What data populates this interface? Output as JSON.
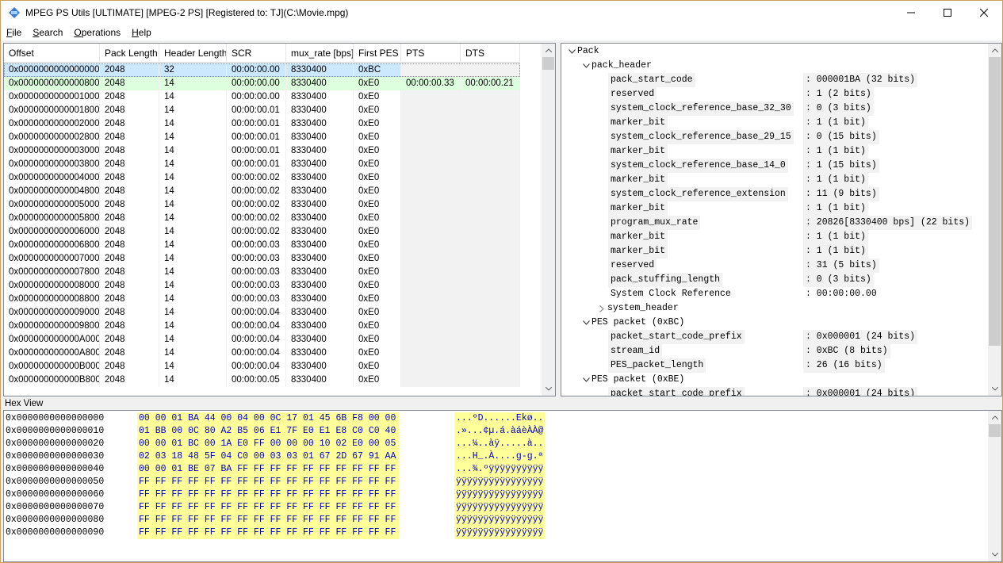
{
  "window": {
    "title": "MPEG PS Utils  [ULTIMATE] [MPEG-2 PS] [Registered to: TJ](C:\\Movie.mpg)"
  },
  "menu": [
    {
      "u": "F",
      "rest": "ile"
    },
    {
      "u": "S",
      "rest": "earch"
    },
    {
      "u": "O",
      "rest": "perations"
    },
    {
      "u": "H",
      "rest": "elp"
    }
  ],
  "grid": {
    "columns": [
      "Offset",
      "Pack Length",
      "Header Length",
      "SCR",
      "mux_rate [bps]",
      "First PES",
      "PTS",
      "DTS"
    ],
    "rows": [
      [
        "0x0000000000000000",
        "2048",
        "32",
        "00:00:00.00",
        "8330400",
        "0xBC",
        "",
        ""
      ],
      [
        "0x0000000000000800",
        "2048",
        "14",
        "00:00:00.00",
        "8330400",
        "0xE0",
        "00:00:00.33",
        "00:00:00.21"
      ],
      [
        "0x0000000000001000",
        "2048",
        "14",
        "00:00:00.00",
        "8330400",
        "0xE0",
        "",
        ""
      ],
      [
        "0x0000000000001800",
        "2048",
        "14",
        "00:00:00.01",
        "8330400",
        "0xE0",
        "",
        ""
      ],
      [
        "0x0000000000002000",
        "2048",
        "14",
        "00:00:00.01",
        "8330400",
        "0xE0",
        "",
        ""
      ],
      [
        "0x0000000000002800",
        "2048",
        "14",
        "00:00:00.01",
        "8330400",
        "0xE0",
        "",
        ""
      ],
      [
        "0x0000000000003000",
        "2048",
        "14",
        "00:00:00.01",
        "8330400",
        "0xE0",
        "",
        ""
      ],
      [
        "0x0000000000003800",
        "2048",
        "14",
        "00:00:00.01",
        "8330400",
        "0xE0",
        "",
        ""
      ],
      [
        "0x0000000000004000",
        "2048",
        "14",
        "00:00:00.02",
        "8330400",
        "0xE0",
        "",
        ""
      ],
      [
        "0x0000000000004800",
        "2048",
        "14",
        "00:00:00.02",
        "8330400",
        "0xE0",
        "",
        ""
      ],
      [
        "0x0000000000005000",
        "2048",
        "14",
        "00:00:00.02",
        "8330400",
        "0xE0",
        "",
        ""
      ],
      [
        "0x0000000000005800",
        "2048",
        "14",
        "00:00:00.02",
        "8330400",
        "0xE0",
        "",
        ""
      ],
      [
        "0x0000000000006000",
        "2048",
        "14",
        "00:00:00.02",
        "8330400",
        "0xE0",
        "",
        ""
      ],
      [
        "0x0000000000006800",
        "2048",
        "14",
        "00:00:00.03",
        "8330400",
        "0xE0",
        "",
        ""
      ],
      [
        "0x0000000000007000",
        "2048",
        "14",
        "00:00:00.03",
        "8330400",
        "0xE0",
        "",
        ""
      ],
      [
        "0x0000000000007800",
        "2048",
        "14",
        "00:00:00.03",
        "8330400",
        "0xE0",
        "",
        ""
      ],
      [
        "0x0000000000008000",
        "2048",
        "14",
        "00:00:00.03",
        "8330400",
        "0xE0",
        "",
        ""
      ],
      [
        "0x0000000000008800",
        "2048",
        "14",
        "00:00:00.03",
        "8330400",
        "0xE0",
        "",
        ""
      ],
      [
        "0x0000000000009000",
        "2048",
        "14",
        "00:00:00.04",
        "8330400",
        "0xE0",
        "",
        ""
      ],
      [
        "0x0000000000009800",
        "2048",
        "14",
        "00:00:00.04",
        "8330400",
        "0xE0",
        "",
        ""
      ],
      [
        "0x000000000000A000",
        "2048",
        "14",
        "00:00:00.04",
        "8330400",
        "0xE0",
        "",
        ""
      ],
      [
        "0x000000000000A800",
        "2048",
        "14",
        "00:00:00.04",
        "8330400",
        "0xE0",
        "",
        ""
      ],
      [
        "0x000000000000B000",
        "2048",
        "14",
        "00:00:00.04",
        "8330400",
        "0xE0",
        "",
        ""
      ],
      [
        "0x000000000000B800",
        "2048",
        "14",
        "00:00:00.05",
        "8330400",
        "0xE0",
        "",
        ""
      ]
    ],
    "selected_row": 0,
    "highlight_row": 1
  },
  "tree": [
    {
      "level": 0,
      "expander": "open",
      "label": "Pack"
    },
    {
      "level": 1,
      "expander": "open",
      "label": "pack_header"
    },
    {
      "level": 2,
      "field": "pack_start_code",
      "value": ": 000001BA (32 bits)"
    },
    {
      "level": 2,
      "field": "reserved",
      "value": ": 1 (2 bits)"
    },
    {
      "level": 2,
      "field": "system_clock_reference_base_32_30",
      "value": ": 0 (3 bits)"
    },
    {
      "level": 2,
      "field": "marker_bit",
      "value": ": 1 (1 bit)"
    },
    {
      "level": 2,
      "field": "system_clock_reference_base_29_15",
      "value": ": 0 (15 bits)"
    },
    {
      "level": 2,
      "field": "marker_bit",
      "value": ": 1 (1 bit)"
    },
    {
      "level": 2,
      "field": "system_clock_reference_base_14_0",
      "value": ": 1 (15 bits)"
    },
    {
      "level": 2,
      "field": "marker_bit",
      "value": ": 1 (1 bit)"
    },
    {
      "level": 2,
      "field": "system_clock_reference_extension",
      "value": ": 11 (9 bits)"
    },
    {
      "level": 2,
      "field": "marker_bit",
      "value": ": 1 (1 bit)"
    },
    {
      "level": 2,
      "field": "program_mux_rate",
      "value": ": 20826[8330400 bps] (22 bits)"
    },
    {
      "level": 2,
      "field": "marker_bit",
      "value": ": 1 (1 bit)"
    },
    {
      "level": 2,
      "field": "marker_bit",
      "value": ": 1 (1 bit)"
    },
    {
      "level": 2,
      "field": "reserved",
      "value": ": 31 (5 bits)"
    },
    {
      "level": 2,
      "field": "pack_stuffing_length",
      "value": ": 0 (3 bits)"
    },
    {
      "level": 2,
      "field": "System Clock Reference",
      "value": ": 00:00:00.00",
      "plain": true
    },
    {
      "level": 1,
      "expander": "closed",
      "label": "system_header",
      "indent2": true
    },
    {
      "level": 1,
      "expander": "open",
      "label": "PES packet (0xBC)"
    },
    {
      "level": 2,
      "field": "packet_start_code_prefix",
      "value": ": 0x000001 (24 bits)"
    },
    {
      "level": 2,
      "field": "stream_id",
      "value": ": 0xBC (8 bits)"
    },
    {
      "level": 2,
      "field": "PES_packet_length",
      "value": ": 26 (16 bits)"
    },
    {
      "level": 1,
      "expander": "open",
      "label": "PES packet (0xBE)"
    },
    {
      "level": 2,
      "field": "packet_start_code_prefix",
      "value": ": 0x000001 (24 bits)"
    }
  ],
  "hex": {
    "label": "Hex View",
    "rows": [
      {
        "offset": "0x0000000000000000",
        "bytes": "00 00 01 BA 44 00 04 00 0C 17 01 45 6B F8 00 00",
        "ascii": "...ºD......Ekø.."
      },
      {
        "offset": "0x0000000000000010",
        "bytes": "01 BB 00 0C 80 A2 B5 06 E1 7F E0 E1 E8 C0 C0 40",
        "ascii": ".»...¢µ.á.àáèÀÀ@"
      },
      {
        "offset": "0x0000000000000020",
        "bytes": "00 00 01 BC 00 1A E0 FF 00 00 00 10 02 E0 00 05",
        "ascii": "...¼..àÿ.....à.."
      },
      {
        "offset": "0x0000000000000030",
        "bytes": "02 03 18 48 5F 04 C0 00 03 03 01 67 2D 67 91 AA",
        "ascii": "...H_.À....g-g.ª"
      },
      {
        "offset": "0x0000000000000040",
        "bytes": "00 00 01 BE 07 BA FF FF FF FF FF FF FF FF FF FF",
        "ascii": "...¾.ºÿÿÿÿÿÿÿÿÿÿ"
      },
      {
        "offset": "0x0000000000000050",
        "bytes": "FF FF FF FF FF FF FF FF FF FF FF FF FF FF FF FF",
        "ascii": "ÿÿÿÿÿÿÿÿÿÿÿÿÿÿÿÿ"
      },
      {
        "offset": "0x0000000000000060",
        "bytes": "FF FF FF FF FF FF FF FF FF FF FF FF FF FF FF FF",
        "ascii": "ÿÿÿÿÿÿÿÿÿÿÿÿÿÿÿÿ"
      },
      {
        "offset": "0x0000000000000070",
        "bytes": "FF FF FF FF FF FF FF FF FF FF FF FF FF FF FF FF",
        "ascii": "ÿÿÿÿÿÿÿÿÿÿÿÿÿÿÿÿ"
      },
      {
        "offset": "0x0000000000000080",
        "bytes": "FF FF FF FF FF FF FF FF FF FF FF FF FF FF FF FF",
        "ascii": "ÿÿÿÿÿÿÿÿÿÿÿÿÿÿÿÿ"
      },
      {
        "offset": "0x0000000000000090",
        "bytes": "FF FF FF FF FF FF FF FF FF FF FF FF FF FF FF FF",
        "ascii": "ÿÿÿÿÿÿÿÿÿÿÿÿÿÿÿÿ"
      }
    ]
  },
  "colors": {
    "selection": "#cce8ff",
    "highlight": "#ddffdd",
    "hex_bg": "#ffff99",
    "hex_fg": "#0000cc"
  }
}
